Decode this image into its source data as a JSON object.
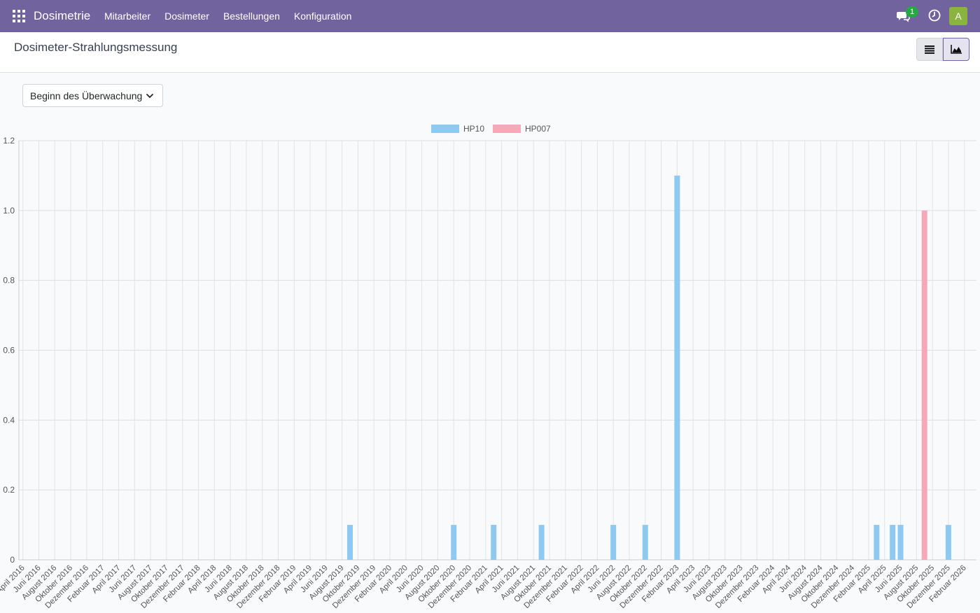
{
  "app": {
    "brand": "Dosimetrie",
    "menu": [
      "Mitarbeiter",
      "Dosimeter",
      "Bestellungen",
      "Konfiguration"
    ],
    "notification_count": "1",
    "avatar_letter": "A",
    "header_color": "#71639e",
    "avatar_color": "#8bb43f"
  },
  "page": {
    "title": "Dosimeter-Strahlungsmessung",
    "groupby_value": "Beginn des Überwachungszeitraums"
  },
  "chart_data": {
    "type": "bar",
    "x_start": "April 2016",
    "x_labels": [
      "April 2016",
      "Juni 2016",
      "August 2016",
      "Oktober 2016",
      "Dezember 2016",
      "Februar 2017",
      "April 2017",
      "Juni 2017",
      "August 2017",
      "Oktober 2017",
      "Dezember 2017",
      "Februar 2018",
      "April 2018",
      "Juni 2018",
      "August 2018",
      "Oktober 2018",
      "Dezember 2018",
      "Februar 2019",
      "April 2019",
      "Juni 2019",
      "August 2019",
      "Oktober 2019",
      "Dezember 2019",
      "Februar 2020",
      "April 2020",
      "Juni 2020",
      "August 2020",
      "Oktober 2020",
      "Dezember 2020",
      "Februar 2021",
      "April 2021",
      "Juni 2021",
      "August 2021",
      "Oktober 2021",
      "Dezember 2021",
      "Februar 2022",
      "April 2022",
      "Juni 2022",
      "August 2022",
      "Oktober 2022",
      "Dezember 2022",
      "Februar 2023",
      "April 2023",
      "Juni 2023",
      "August 2023",
      "Oktober 2023",
      "Dezember 2023",
      "Februar 2024",
      "April 2024",
      "Juni 2024",
      "August 2024",
      "Oktober 2024",
      "Dezember 2024",
      "Februar 2025",
      "April 2025",
      "Juni 2025",
      "August 2025",
      "Oktober 2025",
      "Dezember 2025",
      "Februar 2026"
    ],
    "ylim": [
      0,
      1.2
    ],
    "y_ticks": [
      "0",
      "0.2",
      "0.4",
      "0.6",
      "0.8",
      "1.0",
      "1.2"
    ],
    "grid": true,
    "legend_position": "top-center",
    "series": [
      {
        "name": "HP10",
        "color": "#8ec9f1",
        "points": [
          {
            "x": "September 2019",
            "y": 0.1
          },
          {
            "x": "Oktober 2020",
            "y": 0.1
          },
          {
            "x": "März 2021",
            "y": 0.1
          },
          {
            "x": "September 2021",
            "y": 0.1
          },
          {
            "x": "Juni 2022",
            "y": 0.1
          },
          {
            "x": "Oktober 2022",
            "y": 0.1
          },
          {
            "x": "Februar 2023",
            "y": 1.1
          },
          {
            "x": "März 2025",
            "y": 0.1
          },
          {
            "x": "Mai 2025",
            "y": 0.1
          },
          {
            "x": "Juni 2025",
            "y": 0.1
          },
          {
            "x": "Dezember 2025",
            "y": 0.1
          }
        ]
      },
      {
        "name": "HP007",
        "color": "#f7a8b8",
        "points": [
          {
            "x": "September 2025",
            "y": 1.0
          }
        ]
      }
    ]
  }
}
